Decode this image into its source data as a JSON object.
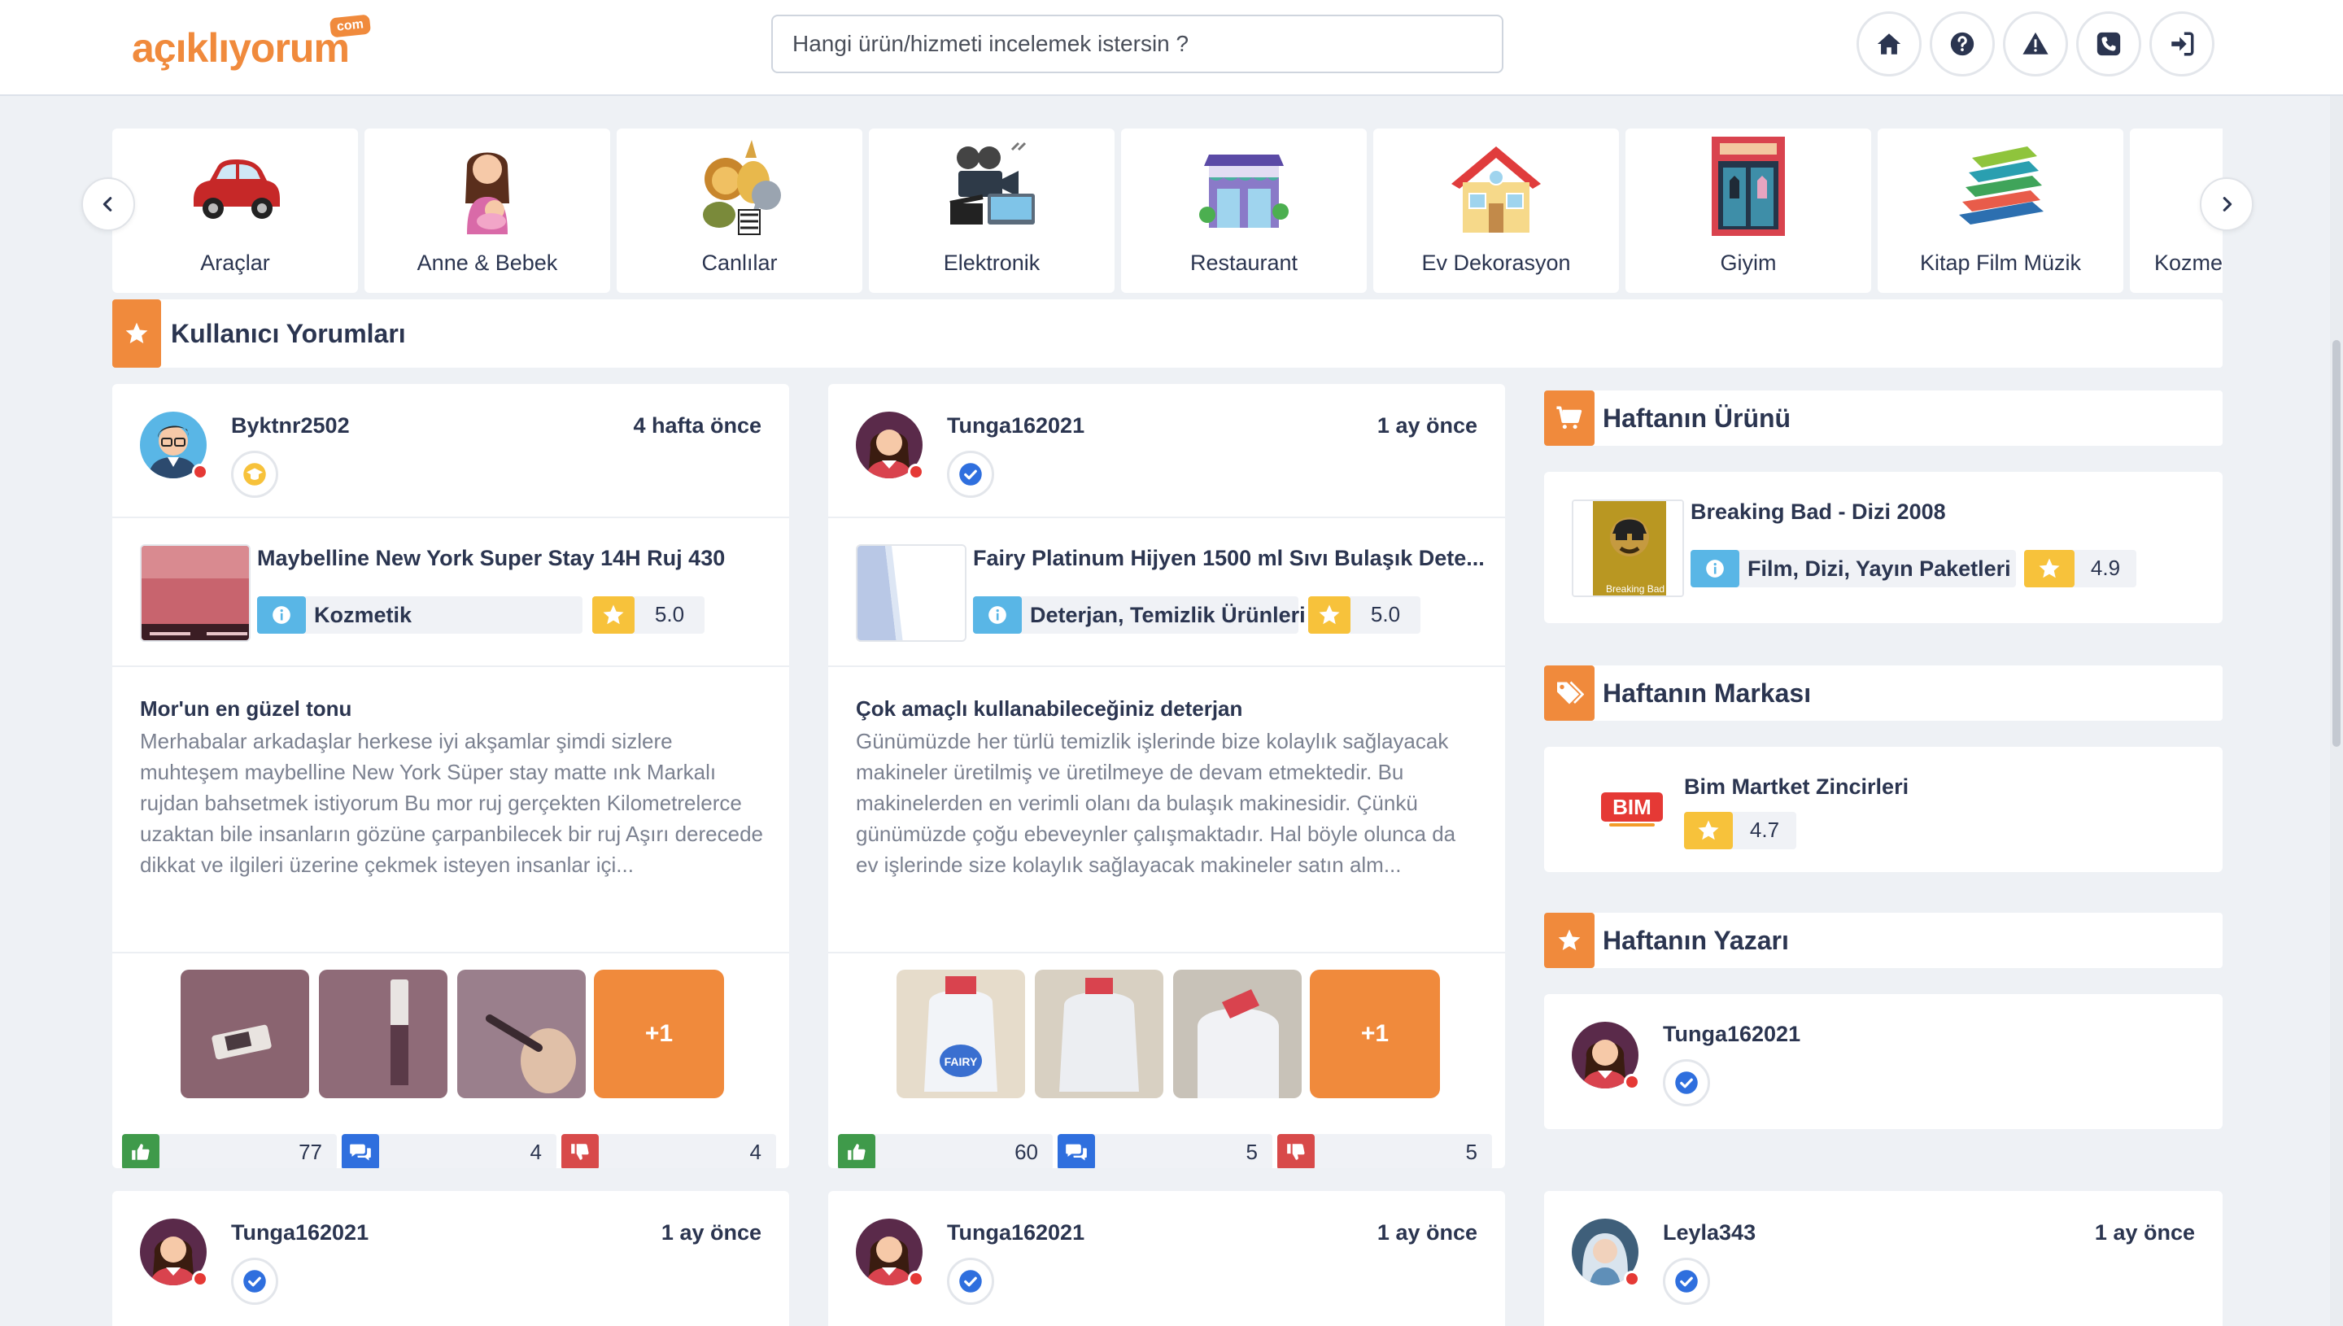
{
  "header": {
    "logo_text": "açıklıyorum",
    "logo_com": "com",
    "search_placeholder": "Hangi ürün/hizmeti incelemek istersin ?",
    "buttons": [
      "home-icon",
      "question-icon",
      "warning-icon",
      "phone-icon",
      "login-icon"
    ]
  },
  "categories": [
    "Araçlar",
    "Anne & Bebek",
    "Canlılar",
    "Elektronik",
    "Restaurant",
    "Ev Dekorasyon",
    "Giyim",
    "Kitap Film Müzik",
    "Kozmetik"
  ],
  "section": {
    "title": "Kullanıcı Yorumları"
  },
  "reviews": [
    {
      "username": "Byktnr2502",
      "time": "4 hafta önce",
      "product": "Maybelline New York Super Stay 14H Ruj 430",
      "category": "Kozmetik",
      "rating": "5.0",
      "title": "Mor'un en güzel tonu",
      "body": "Merhabalar arkadaşlar herkese iyi akşamlar şimdi sizlere muhteşem maybelline New York Süper stay matte ınk Markalı rujdan bahsetmek istiyorum Bu mor ruj gerçekten Kilometrelerce uzaktan bile insanların gözüne çarpanbilecek bir ruj Aşırı derecede dikkat ve ilgileri üzerine çekmek isteyen insanlar içi...",
      "more": "+1",
      "likes": "77",
      "comments": "4",
      "dislikes": "4"
    },
    {
      "username": "Tunga162021",
      "time": "1 ay önce",
      "product": "Fairy Platinum Hijyen 1500 ml Sıvı Bulaşık Dete...",
      "category": "Deterjan, Temizlik Ürünleri",
      "rating": "5.0",
      "title": "Çok amaçlı kullanabileceğiniz deterjan",
      "body": "Günümüzde her türlü temizlik işlerinde bize kolaylık sağlayacak makineler üretilmiş ve üretilmeye de devam etmektedir. Bu makinelerden en verimli olanı da bulaşık makinesidir. Çünkü günümüzde çoğu ebeveynler çalışmaktadır. Hal böyle olunca da ev işlerinde size kolaylık sağlayacak makineler satın alm...",
      "more": "+1",
      "likes": "60",
      "comments": "5",
      "dislikes": "5"
    }
  ],
  "bottom_reviews": [
    {
      "username": "Tunga162021",
      "time": "1 ay önce"
    },
    {
      "username": "Tunga162021",
      "time": "1 ay önce"
    },
    {
      "username": "Leyla343",
      "time": "1 ay önce"
    }
  ],
  "sidebar": {
    "product_week": {
      "title": "Haftanın Ürünü",
      "name": "Breaking Bad - Dizi 2008",
      "category": "Film, Dizi, Yayın Paketleri",
      "rating": "4.9",
      "poster_text": "Breaking Bad"
    },
    "brand_week": {
      "title": "Haftanın Markası",
      "name": "Bim Martket Zincirleri",
      "logo": "BIM",
      "rating": "4.7"
    },
    "writer_week": {
      "title": "Haftanın Yazarı",
      "name": "Tunga162021"
    }
  },
  "colors": {
    "accent": "#f08a3c",
    "info": "#59b6e6",
    "star": "#f7c23b",
    "like": "#3f9a4a",
    "comment": "#2f6fde",
    "dislike": "#d84a4a",
    "text": "#2b3550"
  }
}
